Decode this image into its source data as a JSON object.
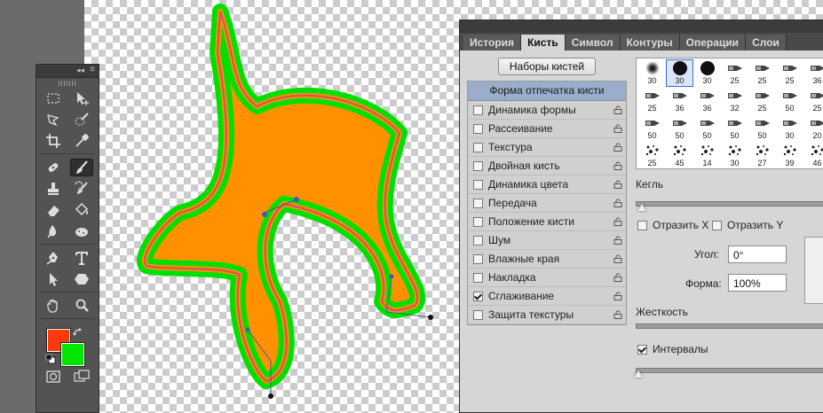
{
  "canvas": {
    "fill_color": "#ff9000",
    "stroke_color": "#00e000",
    "path_color": "#d35a52"
  },
  "tools": {
    "header": {
      "collapse_glyph": "◂◂",
      "menu_glyph": "≡"
    },
    "rows": [
      [
        "marquee-tool-icon",
        "move-tool-icon"
      ],
      [
        "lasso-tool-icon",
        "quick-selection-tool-icon"
      ],
      [
        "crop-tool-icon",
        "eyedropper-tool-icon"
      ],
      [
        "healing-brush-tool-icon",
        "brush-tool-icon"
      ],
      [
        "clone-stamp-tool-icon",
        "history-brush-tool-icon"
      ],
      [
        "eraser-tool-icon",
        "paint-bucket-tool-icon"
      ],
      [
        "blur-tool-icon",
        "sponge-tool-icon"
      ],
      [
        "pen-tool-icon",
        "type-tool-icon"
      ],
      [
        "path-selection-tool-icon",
        "shape-tool-icon"
      ],
      [
        "hand-tool-icon",
        "zoom-tool-icon"
      ]
    ],
    "active_tool": "brush-tool-icon",
    "foreground_color": "#ff3a0a",
    "background_color": "#00e600"
  },
  "panel": {
    "tabs": [
      "История",
      "Кисть",
      "Символ",
      "Контуры",
      "Операции",
      "Слои"
    ],
    "active_tab": "Кисть",
    "presets_button": "Наборы кистей",
    "options_header": "Форма отпечатка кисти",
    "options": [
      {
        "label": "Динамика формы",
        "checked": false
      },
      {
        "label": "Рассеивание",
        "checked": false
      },
      {
        "label": "Текстура",
        "checked": false
      },
      {
        "label": "Двойная кисть",
        "checked": false
      },
      {
        "label": "Динамика цвета",
        "checked": false
      },
      {
        "label": "Передача",
        "checked": false
      },
      {
        "label": "Положение кисти",
        "checked": false
      },
      {
        "label": "Шум",
        "checked": false
      },
      {
        "label": "Влажные края",
        "checked": false
      },
      {
        "label": "Накладка",
        "checked": false
      },
      {
        "label": "Сглаживание",
        "checked": true
      },
      {
        "label": "Защита текстуры",
        "checked": false
      }
    ],
    "brush_tips": [
      {
        "size": "30",
        "kind": "soft"
      },
      {
        "size": "30",
        "kind": "hard"
      },
      {
        "size": "30",
        "kind": "hard"
      },
      {
        "size": "25",
        "kind": "tip"
      },
      {
        "size": "25",
        "kind": "tip"
      },
      {
        "size": "25",
        "kind": "tip"
      },
      {
        "size": "36",
        "kind": "tip"
      },
      {
        "size": "25",
        "kind": "tip"
      },
      {
        "size": "36",
        "kind": "tip"
      },
      {
        "size": "36",
        "kind": "tip"
      },
      {
        "size": "32",
        "kind": "tip"
      },
      {
        "size": "25",
        "kind": "tip"
      },
      {
        "size": "50",
        "kind": "tip"
      },
      {
        "size": "25",
        "kind": "tip"
      },
      {
        "size": "50",
        "kind": "tip"
      },
      {
        "size": "50",
        "kind": "tip"
      },
      {
        "size": "50",
        "kind": "tip"
      },
      {
        "size": "50",
        "kind": "tip"
      },
      {
        "size": "50",
        "kind": "tip"
      },
      {
        "size": "30",
        "kind": "tip"
      },
      {
        "size": "20",
        "kind": "tip"
      },
      {
        "size": "25",
        "kind": "scatter"
      },
      {
        "size": "45",
        "kind": "scatter"
      },
      {
        "size": "14",
        "kind": "scatter"
      },
      {
        "size": "30",
        "kind": "scatter"
      },
      {
        "size": "27",
        "kind": "scatter"
      },
      {
        "size": "39",
        "kind": "scatter"
      },
      {
        "size": "46",
        "kind": "scatter"
      }
    ],
    "size_label": "Кегль",
    "flip_x": "Отразить X",
    "flip_y": "Отразить Y",
    "angle_label": "Угол:",
    "angle_value": "0°",
    "roundness_label": "Форма:",
    "roundness_value": "100%",
    "hardness_label": "Жесткость",
    "spacing_label": "Интервалы",
    "spacing_checked": true
  }
}
